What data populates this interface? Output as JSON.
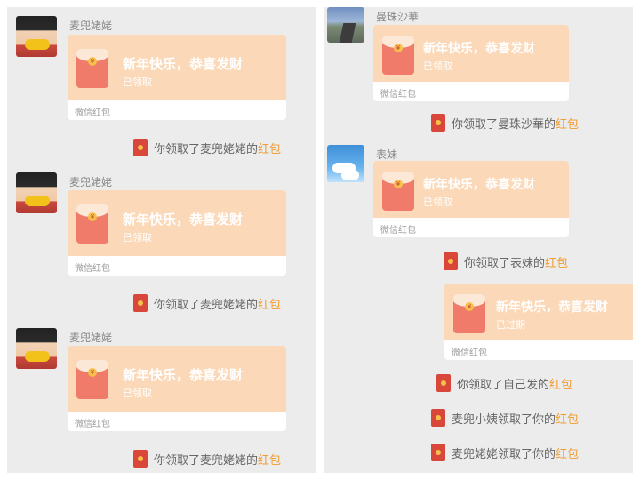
{
  "left": {
    "messages": [
      {
        "sender": "麦兜姥姥",
        "greeting": "新年快乐，恭喜发财",
        "status": "已领取",
        "footer": "微信红包",
        "notice": {
          "prefix": "你领取了麦兜姥姥的",
          "highlight": "红包"
        }
      },
      {
        "sender": "麦兜姥姥",
        "greeting": "新年快乐，恭喜发财",
        "status": "已领取",
        "footer": "微信红包",
        "notice": {
          "prefix": "你领取了麦兜姥姥的",
          "highlight": "红包"
        }
      },
      {
        "sender": "麦兜姥姥",
        "greeting": "新年快乐，恭喜发财",
        "status": "已领取",
        "footer": "微信红包",
        "notice": {
          "prefix": "你领取了麦兜姥姥的",
          "highlight": "红包"
        }
      }
    ]
  },
  "right": {
    "messages": [
      {
        "sender": "曼珠沙華",
        "greeting": "新年快乐，恭喜发财",
        "status": "已领取",
        "footer": "微信红包",
        "notice": {
          "prefix": "你领取了曼珠沙華的",
          "highlight": "红包"
        }
      },
      {
        "sender": "表妹",
        "greeting": "新年快乐，恭喜发财",
        "status": "已领取",
        "footer": "微信红包",
        "notice": {
          "prefix": "你领取了表妹的",
          "highlight": "红包"
        }
      }
    ],
    "own_message": {
      "greeting": "新年快乐，恭喜发财",
      "status": "已过期",
      "footer": "微信红包"
    },
    "notices": [
      {
        "prefix": "你领取了自己发的",
        "highlight": "红包"
      },
      {
        "prefix": "麦兜小姨领取了你的",
        "highlight": "红包"
      },
      {
        "prefix": "麦兜姥姥领取了你的",
        "highlight": "红包"
      }
    ]
  },
  "colors": {
    "card_top": "#fbd8b7",
    "highlight": "#f29b2e",
    "envelope": "#f07b6a",
    "notice_icon": "#d9473a"
  },
  "icons": {
    "avatar_1": "girl-eating-corn-avatar",
    "avatar_2": "road-avatar",
    "avatar_3": "sky-clouds-avatar",
    "envelope": "red-envelope-icon"
  }
}
